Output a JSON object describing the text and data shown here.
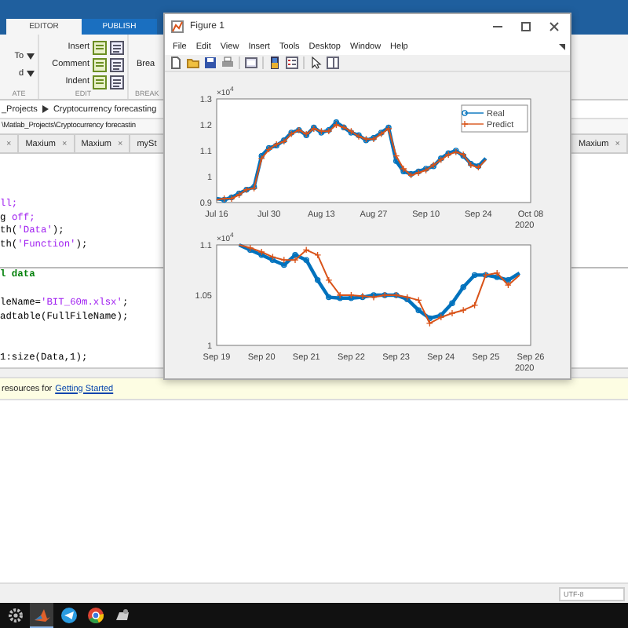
{
  "toolstrip_tabs": [
    {
      "label": "EDITOR",
      "selected": true
    },
    {
      "label": "PUBLISH",
      "selected": false
    }
  ],
  "ribbon": {
    "groups": [
      {
        "label": "ATE",
        "buttons": [
          "To",
          "d"
        ]
      },
      {
        "label": "EDIT",
        "buttons": [
          "Insert",
          "Comment",
          "Indent"
        ]
      },
      {
        "label": "BREAK",
        "buttons": [
          "Brea"
        ]
      }
    ]
  },
  "breadcrumb": [
    "_Projects",
    "Cryptocurrency forecasting"
  ],
  "path": "\\Matlab_Projects\\Cryptocurrency forecastin",
  "file_tabs": [
    {
      "close": "×"
    },
    {
      "label": "Maxium",
      "close": "×"
    },
    {
      "label": "Maxium",
      "close": "×"
    },
    {
      "label": "mySt"
    }
  ],
  "right_tabs": [
    {
      "label": "Maxium",
      "close": "×"
    }
  ],
  "code_lines": [
    {
      "kind": "blank"
    },
    {
      "kind": "blank"
    },
    {
      "kind": "blank"
    },
    {
      "kind": "code",
      "segments": [
        {
          "kind": "string",
          "text": "ll;"
        }
      ]
    },
    {
      "kind": "code",
      "segments": [
        {
          "kind": "plain",
          "text": "g "
        },
        {
          "kind": "string",
          "text": "off;"
        }
      ]
    },
    {
      "kind": "code",
      "segments": [
        {
          "kind": "plain",
          "text": "th("
        },
        {
          "kind": "string",
          "text": "'Data'"
        },
        {
          "kind": "plain",
          "text": ");"
        }
      ]
    },
    {
      "kind": "code",
      "segments": [
        {
          "kind": "plain",
          "text": "th("
        },
        {
          "kind": "string",
          "text": "'Function'"
        },
        {
          "kind": "plain",
          "text": ");"
        }
      ]
    },
    {
      "kind": "blank"
    },
    {
      "kind": "section",
      "segments": [
        {
          "kind": "plain",
          "text": "l data"
        }
      ]
    },
    {
      "kind": "blank"
    },
    {
      "kind": "code",
      "segments": [
        {
          "kind": "plain",
          "text": "leName="
        },
        {
          "kind": "string",
          "text": "'BIT_60m.xlsx'"
        },
        {
          "kind": "plain",
          "text": ";"
        }
      ]
    },
    {
      "kind": "code",
      "segments": [
        {
          "kind": "plain",
          "text": "adtable(FullFileName);"
        }
      ]
    },
    {
      "kind": "blank"
    },
    {
      "kind": "blank"
    },
    {
      "kind": "code",
      "segments": [
        {
          "kind": "plain",
          "text": "1:size(Data,1);"
        }
      ]
    }
  ],
  "info_bar": {
    "text": "resources for",
    "link": "Getting Started"
  },
  "status_bar": {
    "encoding": "UTF-8"
  },
  "taskbar": {
    "apps": [
      {
        "kind": "gear",
        "selected": false
      },
      {
        "kind": "matlab",
        "selected": true
      },
      {
        "kind": "messenger",
        "selected": false
      },
      {
        "kind": "browser",
        "selected": false
      },
      {
        "kind": "app",
        "selected": false
      }
    ]
  },
  "figure": {
    "title": "Figure 1",
    "menu": [
      "File",
      "Edit",
      "View",
      "Insert",
      "Tools",
      "Desktop",
      "Window",
      "Help"
    ],
    "plots": [
      {
        "exponent_label": "×10$^{4}$",
        "year_label": "2020",
        "chart_data": {
          "type": "line",
          "legend": "upper right",
          "categories": [
            "Jul 16",
            null,
            null,
            null,
            null,
            null,
            null,
            "Jul 30",
            null,
            null,
            null,
            null,
            null,
            null,
            "Aug 13",
            null,
            null,
            null,
            null,
            null,
            null,
            "Aug 27",
            null,
            null,
            null,
            null,
            null,
            null,
            "Sep 10",
            null,
            null,
            null,
            null,
            null,
            null,
            "Sep 24",
            null,
            null,
            null,
            null,
            null,
            null,
            "Oct 08"
          ],
          "series": [
            {
              "name": "Real",
              "color": "#0072bd",
              "values": [
                0.915,
                0.91,
                0.92,
                0.935,
                0.95,
                0.96,
                1.08,
                1.11,
                1.12,
                1.14,
                1.17,
                1.18,
                1.16,
                1.19,
                1.17,
                1.18,
                1.21,
                1.19,
                1.17,
                1.16,
                1.14,
                1.15,
                1.17,
                1.19,
                1.06,
                1.02,
                1.01,
                1.02,
                1.03,
                1.04,
                1.07,
                1.09,
                1.1,
                1.08,
                1.05,
                1.04,
                1.07,
                null,
                null,
                null,
                null,
                null,
                null
              ]
            },
            {
              "name": "Predict",
              "color": "#d95319",
              "values": [
                0.91,
                0.915,
                0.915,
                0.93,
                0.95,
                0.955,
                1.07,
                1.105,
                1.125,
                1.135,
                1.165,
                1.18,
                1.165,
                1.185,
                1.175,
                1.175,
                1.2,
                1.19,
                1.175,
                1.155,
                1.145,
                1.145,
                1.165,
                1.185,
                1.08,
                1.03,
                1.005,
                1.015,
                1.025,
                1.045,
                1.065,
                1.085,
                1.095,
                1.085,
                1.045,
                1.035,
                1.065,
                null,
                null,
                null,
                null,
                null,
                null
              ]
            }
          ],
          "ylim": [
            0.9,
            1.3
          ],
          "yticks": [
            0.9,
            1,
            1.1,
            1.2,
            1.3
          ]
        }
      },
      {
        "exponent_label": "×10$^{4}$",
        "year_label": "2020",
        "chart_data": {
          "type": "line",
          "categories": [
            "Sep 19",
            null,
            null,
            null,
            "Sep 20",
            null,
            null,
            null,
            "Sep 21",
            null,
            null,
            null,
            "Sep 22",
            null,
            null,
            null,
            "Sep 23",
            null,
            null,
            null,
            "Sep 24",
            null,
            null,
            null,
            "Sep 25",
            null,
            null,
            null,
            "Sep 26"
          ],
          "series": [
            {
              "color": "#0072bd",
              "values": [
                null,
                null,
                1.1,
                1.095,
                1.09,
                1.085,
                1.08,
                1.09,
                1.085,
                1.065,
                1.048,
                1.047,
                1.047,
                1.048,
                1.05,
                1.05,
                1.05,
                1.046,
                1.035,
                1.027,
                1.03,
                1.042,
                1.058,
                1.07,
                1.07,
                1.068,
                1.065,
                1.072,
                null
              ]
            },
            {
              "color": "#d95319",
              "values": [
                null,
                null,
                1.1,
                1.097,
                1.093,
                1.088,
                1.085,
                1.085,
                1.095,
                1.09,
                1.065,
                1.05,
                1.05,
                1.049,
                1.048,
                1.05,
                1.05,
                1.048,
                1.045,
                1.022,
                1.028,
                1.032,
                1.035,
                1.04,
                1.07,
                1.072,
                1.06,
                1.07,
                null
              ]
            }
          ],
          "ylim": [
            1,
            1.1
          ],
          "yticks": [
            1,
            1.05,
            1.1
          ]
        }
      }
    ]
  }
}
